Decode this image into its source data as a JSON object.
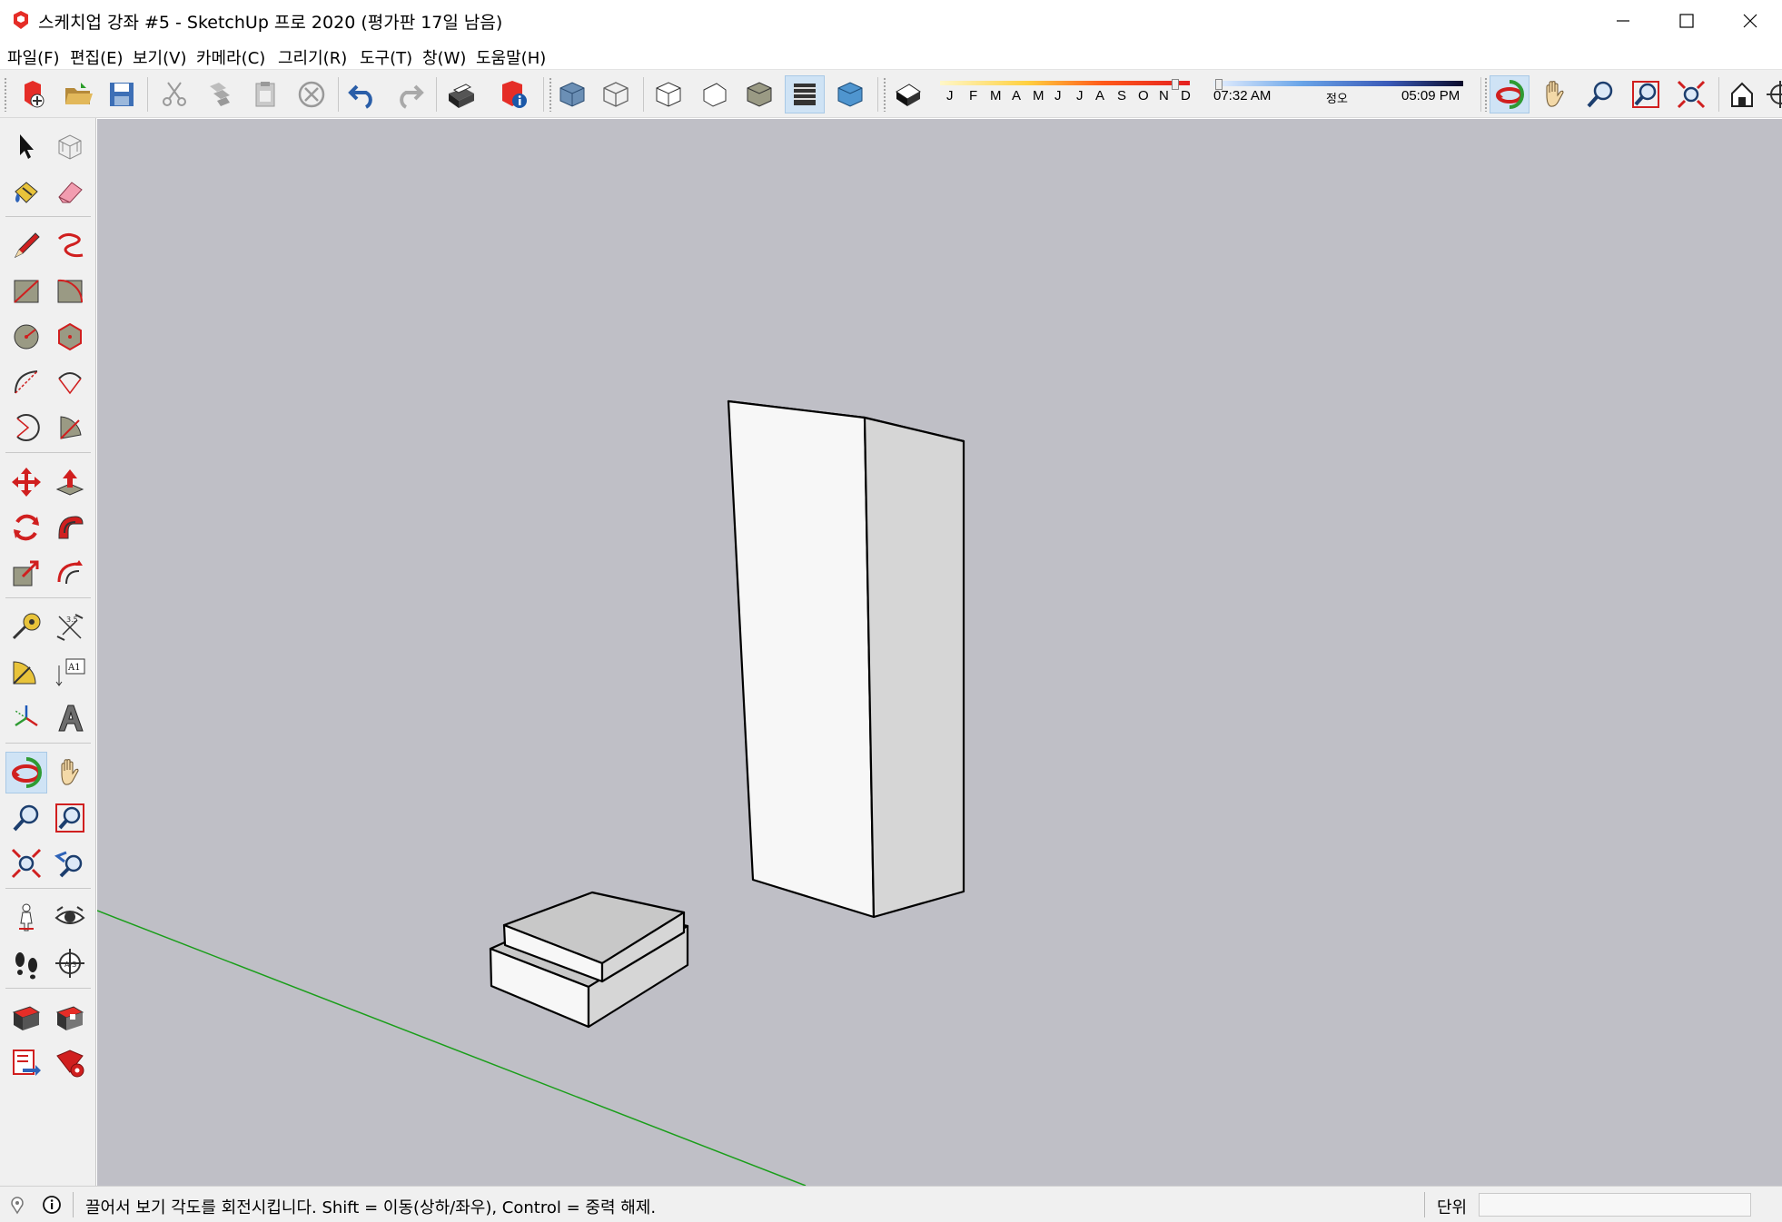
{
  "window": {
    "title": "스케치업 강좌 #5 - SketchUp 프로 2020 (평가판 17일 남음)",
    "controls": [
      "minimize",
      "maximize",
      "close"
    ]
  },
  "menu": [
    "파일(F)",
    "편집(E)",
    "보기(V)",
    "카메라(C)",
    "그리기(R)",
    "도구(T)",
    "창(W)",
    "도움말(H)"
  ],
  "toolbar": {
    "icons": [
      "new-file-icon",
      "open-folder-icon",
      "save-icon",
      "cut-icon",
      "copy-icon",
      "paste-icon",
      "erase-icon",
      "undo-icon",
      "redo-icon",
      "print-icon",
      "model-info-icon",
      "xray-icon",
      "wireframe-icon",
      "hidden-line-icon",
      "shaded-icon",
      "shaded-textures-icon",
      "monochrome-icon",
      "shadows-icon",
      "orbit-icon",
      "pan-icon",
      "zoom-icon",
      "zoom-window-icon",
      "zoom-extents-icon",
      "warehouse-icon"
    ],
    "shadow_months": [
      "J",
      "F",
      "M",
      "A",
      "M",
      "J",
      "J",
      "A",
      "S",
      "O",
      "N",
      "D"
    ],
    "time_start": "07:32 AM",
    "time_mid": "정오",
    "time_end": "05:09 PM",
    "active_style": "shaded-textures-icon",
    "active_camera": "orbit-icon"
  },
  "palette": {
    "icons": [
      "select-icon",
      "component-icon",
      "paint-bucket-icon",
      "eraser-icon",
      "line-icon",
      "freehand-icon",
      "rectangle-icon",
      "rotated-rectangle-icon",
      "circle-icon",
      "polygon-icon",
      "arc-icon",
      "two-point-arc-icon",
      "three-point-arc-icon",
      "pie-icon",
      "move-icon",
      "push-pull-icon",
      "rotate-icon",
      "follow-me-icon",
      "scale-icon",
      "offset-icon",
      "tape-measure-icon",
      "dimension-icon",
      "protractor-icon",
      "text-icon",
      "axes-icon",
      "3d-text-icon",
      "orbit-icon",
      "pan-icon",
      "zoom-icon",
      "zoom-window-icon",
      "zoom-extents-icon",
      "previous-view-icon",
      "position-camera-icon",
      "look-around-icon",
      "walk-icon",
      "section-plane-icon",
      "warehouse-icon",
      "extension-warehouse-icon",
      "send-to-layout-icon",
      "extension-manager-icon"
    ],
    "active": "orbit-icon",
    "text_tool_label": "A1"
  },
  "status": {
    "hint": "끌어서 보기 각도를 회전시킵니다. Shift = 이동(상하/좌우), Control = 중력 해제.",
    "units_label": "단위",
    "measurement": ""
  },
  "colors": {
    "viewport": "#bfbfc6",
    "green_axis": "#1a9e1a",
    "front_face": "#f7f7f7",
    "side_face": "#d6d6d6",
    "top_face": "#c3c3c3"
  }
}
